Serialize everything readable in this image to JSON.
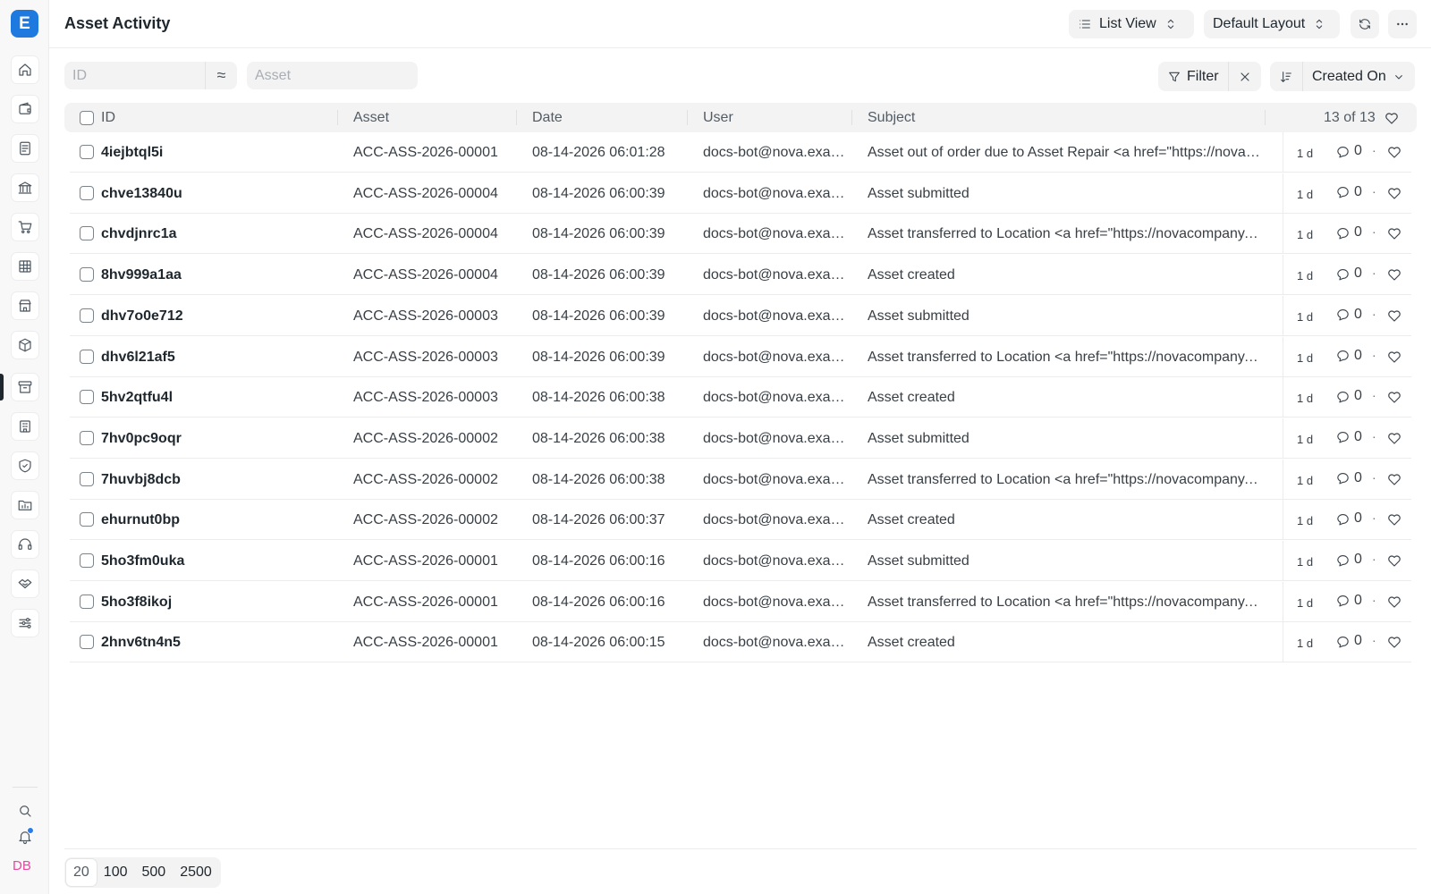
{
  "app": {
    "logo_letter": "E",
    "user_initials": "DB"
  },
  "header": {
    "title": "Asset Activity",
    "view_label": "List View",
    "layout_label": "Default Layout"
  },
  "filters": {
    "id_placeholder": "ID",
    "asset_placeholder": "Asset",
    "like_symbol": "≈",
    "filter_label": "Filter",
    "sort_label": "Created On"
  },
  "table": {
    "columns": {
      "id": "ID",
      "asset": "Asset",
      "date": "Date",
      "user": "User",
      "subject": "Subject"
    },
    "count": "13 of 13",
    "rows": [
      {
        "id": "4iejbtql5i",
        "asset": "ACC-ASS-2026-00001",
        "date": "08-14-2026 06:01:28",
        "user": "docs-bot@nova.example.com",
        "subject": "Asset out of order due to Asset Repair <a href=\"https://novacompany.example.com\">",
        "time": "1 d",
        "comments": "0"
      },
      {
        "id": "chve13840u",
        "asset": "ACC-ASS-2026-00004",
        "date": "08-14-2026 06:00:39",
        "user": "docs-bot@nova.example.com",
        "subject": "Asset submitted",
        "time": "1 d",
        "comments": "0"
      },
      {
        "id": "chvdjnrc1a",
        "asset": "ACC-ASS-2026-00004",
        "date": "08-14-2026 06:00:39",
        "user": "docs-bot@nova.example.com",
        "subject": "Asset transferred to Location <a href=\"https://novacompany.example.com\">",
        "time": "1 d",
        "comments": "0"
      },
      {
        "id": "8hv999a1aa",
        "asset": "ACC-ASS-2026-00004",
        "date": "08-14-2026 06:00:39",
        "user": "docs-bot@nova.example.com",
        "subject": "Asset created",
        "time": "1 d",
        "comments": "0"
      },
      {
        "id": "dhv7o0e712",
        "asset": "ACC-ASS-2026-00003",
        "date": "08-14-2026 06:00:39",
        "user": "docs-bot@nova.example.com",
        "subject": "Asset submitted",
        "time": "1 d",
        "comments": "0"
      },
      {
        "id": "dhv6l21af5",
        "asset": "ACC-ASS-2026-00003",
        "date": "08-14-2026 06:00:39",
        "user": "docs-bot@nova.example.com",
        "subject": "Asset transferred to Location <a href=\"https://novacompany.example.com\">",
        "time": "1 d",
        "comments": "0"
      },
      {
        "id": "5hv2qtfu4l",
        "asset": "ACC-ASS-2026-00003",
        "date": "08-14-2026 06:00:38",
        "user": "docs-bot@nova.example.com",
        "subject": "Asset created",
        "time": "1 d",
        "comments": "0"
      },
      {
        "id": "7hv0pc9oqr",
        "asset": "ACC-ASS-2026-00002",
        "date": "08-14-2026 06:00:38",
        "user": "docs-bot@nova.example.com",
        "subject": "Asset submitted",
        "time": "1 d",
        "comments": "0"
      },
      {
        "id": "7huvbj8dcb",
        "asset": "ACC-ASS-2026-00002",
        "date": "08-14-2026 06:00:38",
        "user": "docs-bot@nova.example.com",
        "subject": "Asset transferred to Location <a href=\"https://novacompany.example.com\">",
        "time": "1 d",
        "comments": "0"
      },
      {
        "id": "ehurnut0bp",
        "asset": "ACC-ASS-2026-00002",
        "date": "08-14-2026 06:00:37",
        "user": "docs-bot@nova.example.com",
        "subject": "Asset created",
        "time": "1 d",
        "comments": "0"
      },
      {
        "id": "5ho3fm0uka",
        "asset": "ACC-ASS-2026-00001",
        "date": "08-14-2026 06:00:16",
        "user": "docs-bot@nova.example.com",
        "subject": "Asset submitted",
        "time": "1 d",
        "comments": "0"
      },
      {
        "id": "5ho3f8ikoj",
        "asset": "ACC-ASS-2026-00001",
        "date": "08-14-2026 06:00:16",
        "user": "docs-bot@nova.example.com",
        "subject": "Asset transferred to Location <a href=\"https://novacompany.example.com\">",
        "time": "1 d",
        "comments": "0"
      },
      {
        "id": "2hnv6tn4n5",
        "asset": "ACC-ASS-2026-00001",
        "date": "08-14-2026 06:00:15",
        "user": "docs-bot@nova.example.com",
        "subject": "Asset created",
        "time": "1 d",
        "comments": "0"
      }
    ]
  },
  "pagination": {
    "sizes": [
      "20",
      "100",
      "500",
      "2500"
    ],
    "selected": "20"
  },
  "sidebar": {
    "icons": [
      "home-icon",
      "wallet-icon",
      "document-icon",
      "bank-icon",
      "cart-icon",
      "table-icon",
      "store-icon",
      "package-icon",
      "archive-icon",
      "building-icon",
      "shield-icon",
      "folder-icon",
      "headset-icon",
      "handshake-icon",
      "sliders-icon"
    ],
    "active": "archive-icon"
  },
  "colors": {
    "accent": "#1f7ae0",
    "user_initials": "#e8479f",
    "notification": "#2b7be8"
  }
}
